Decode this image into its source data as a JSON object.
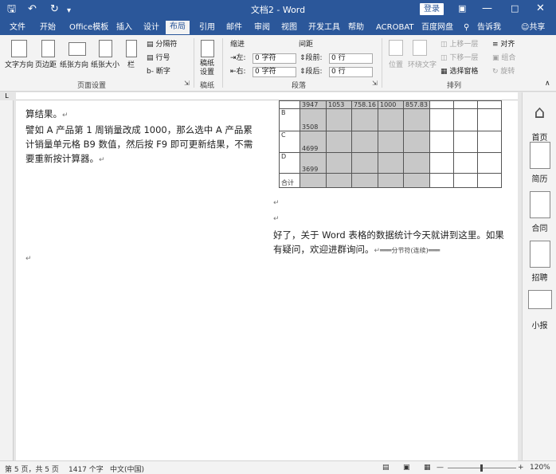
{
  "window": {
    "title": "文档2 - Word",
    "login": "登录"
  },
  "quick_access": {
    "save_icon": "save-icon",
    "undo_icon": "undo-icon",
    "redo_icon": "redo-icon",
    "more_icon": "customize-icon"
  },
  "tabs": [
    "文件",
    "开始",
    "Office模板",
    "插入",
    "设计",
    "布局",
    "引用",
    "邮件",
    "审阅",
    "视图",
    "开发工具",
    "帮助",
    "ACROBAT",
    "百度网盘"
  ],
  "active_tab": "布局",
  "tell_me": "告诉我",
  "share": "共享",
  "ribbon": {
    "page_setup": {
      "text_direction": "文字方向",
      "margins": "页边距",
      "orientation": "纸张方向",
      "size": "纸张大小",
      "columns": "栏",
      "breaks": "分隔符",
      "line_numbers": "行号",
      "hyphenation": "断字",
      "group": "页面设置"
    },
    "paper": {
      "label": "稿纸\n设置",
      "group": "稿纸"
    },
    "paragraph": {
      "indent": "缩进",
      "spacing": "间距",
      "left": "左:",
      "right": "右:",
      "before": "段前:",
      "after": "段后:",
      "indent_left_value": "0 字符",
      "indent_right_value": "0 字符",
      "before_value": "0 行",
      "after_value": "0 行",
      "group": "段落"
    },
    "arrange": {
      "position": "位置",
      "wrap": "环绕文字",
      "forward": "上移一层",
      "backward": "下移一层",
      "selection_pane": "选择窗格",
      "align": "对齐",
      "group_obj": "组合",
      "rotate": "旋转",
      "group": "排列"
    }
  },
  "document": {
    "col1_p1": "算结果。",
    "col1_p2": "譬如 A 产品第 1 周销量改成 1000，那么选中 A 产品累计销量单元格 B9 数值，然后按 F9 即可更新结果，不需要重新按计算器。",
    "mark": "↵",
    "col2_p": "好了，关于 Word 表格的数据统计今天就讲到这里。如果有疑问，欢迎进群询问。",
    "section_break": "分节符(连续)",
    "table": {
      "row0": [
        "",
        "3947",
        "1053",
        "758.16",
        "1000",
        "857.83",
        "",
        "",
        ""
      ],
      "row_b": [
        "B",
        "3508"
      ],
      "row_c": [
        "C",
        "4699"
      ],
      "row_d": [
        "D",
        "3699"
      ],
      "row_total": [
        "合计"
      ]
    }
  },
  "side_pane": [
    "首页",
    "简历",
    "合同",
    "招聘",
    "小报"
  ],
  "status": {
    "page": "第 5 页，共 5 页",
    "words": "1417 个字",
    "lang": "中文(中国)",
    "zoom": "120%"
  }
}
